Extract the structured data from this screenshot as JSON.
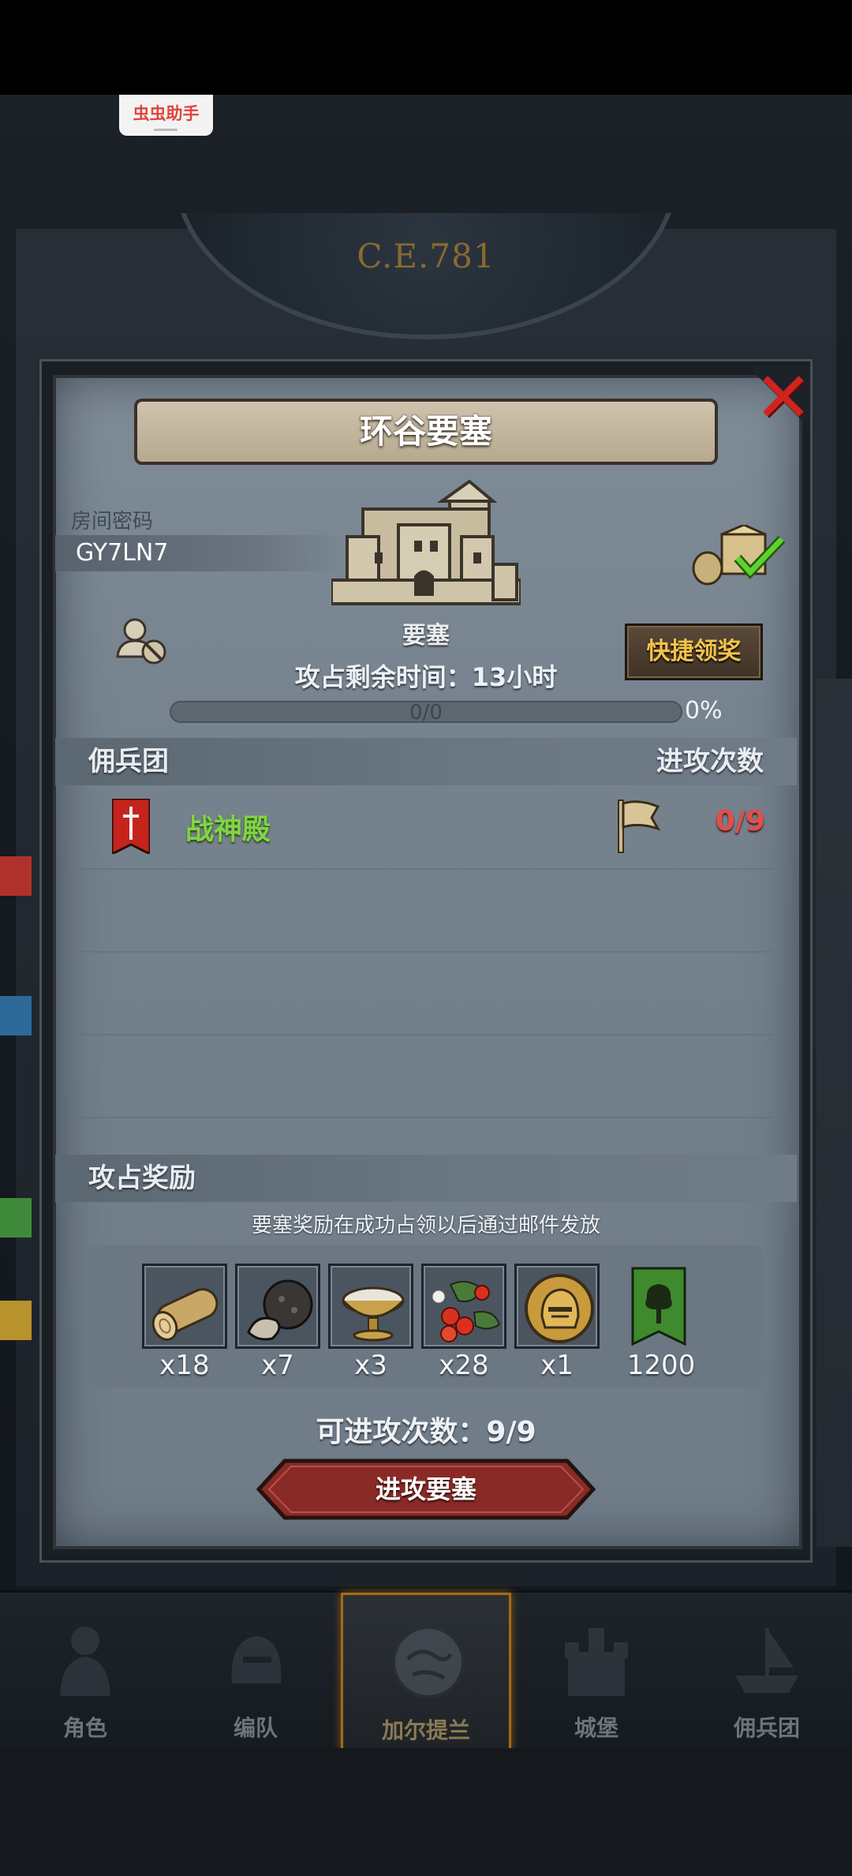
{
  "status_bar": {
    "helper_label": "虫虫助手"
  },
  "clock": {
    "era": "C.E.781"
  },
  "dialog": {
    "title": "环谷要塞",
    "room_label": "房间密码",
    "room_code": "GY7LN7",
    "building_name": "要塞",
    "quick_claim_label": "快捷领奖",
    "time_left": "攻占剩余时间：13小时",
    "progress": {
      "text": "0/0",
      "percent_label": "0%",
      "value": 0
    },
    "mercenary_section": {
      "left": "佣兵团",
      "right": "进攻次数"
    },
    "mercenaries": [
      {
        "name": "战神殿",
        "attacks": "0/9",
        "name_color": "#7fd640",
        "count_color": "#e0504a"
      }
    ],
    "rewards_section": {
      "title": "攻占奖励"
    },
    "reward_note": "要塞奖励在成功占领以后通过邮件发放",
    "rewards": [
      {
        "icon": "wood-log-icon",
        "qty": "x18"
      },
      {
        "icon": "truffle-icon",
        "qty": "x7"
      },
      {
        "icon": "salt-bowl-icon",
        "qty": "x3"
      },
      {
        "icon": "berries-icon",
        "qty": "x28"
      },
      {
        "icon": "knight-helmet-icon",
        "qty": "x1"
      },
      {
        "icon": "guild-banner-icon",
        "qty": "1200"
      }
    ],
    "attack_count": "可进攻次数：9/9",
    "attack_button": "进攻要塞"
  },
  "bottom_nav": {
    "items": [
      {
        "label": "角色",
        "icon": "knight-icon"
      },
      {
        "label": "编队",
        "icon": "helmet-icon"
      },
      {
        "label": "加尔提兰",
        "icon": "world-map-icon"
      },
      {
        "label": "城堡",
        "icon": "castle-icon"
      },
      {
        "label": "佣兵团",
        "icon": "ship-icon"
      }
    ],
    "active_index": 2
  },
  "colors": {
    "accent_gold": "#f2c24a",
    "close_red": "#d2231e",
    "attack_button": "#8a2a26"
  }
}
